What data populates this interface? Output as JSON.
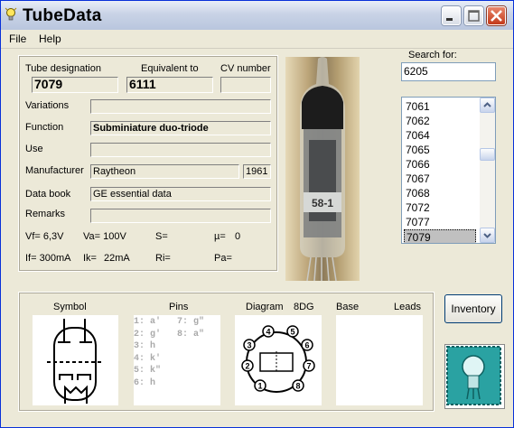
{
  "app": {
    "title": "TubeData"
  },
  "menu": {
    "file": "File",
    "help": "Help"
  },
  "labels": {
    "tube_designation": "Tube designation",
    "equivalent_to": "Equivalent to",
    "cv_number": "CV number",
    "variations": "Variations",
    "function": "Function",
    "use": "Use",
    "manufacturer": "Manufacturer",
    "data_book": "Data book",
    "remarks": "Remarks",
    "search_for": "Search for:"
  },
  "fields": {
    "tube_designation": "7079",
    "equivalent_to": "6111",
    "cv_number": "",
    "variations": "",
    "function": "Subminiature duo-triode",
    "use": "",
    "manufacturer": "Raytheon",
    "year": "1961",
    "data_book": "GE essential data",
    "remarks": ""
  },
  "specs": {
    "vf": "Vf= 6,3V",
    "va": "Va= 100V",
    "s": "S=",
    "mu": "µ=",
    "mu_value": "0",
    "if": "If= 300mA",
    "ik": "Ik=",
    "ik_value": "22mA",
    "ri": "Ri=",
    "pa": "Pa="
  },
  "search": {
    "value": "6205"
  },
  "list": {
    "items": [
      "7061",
      "7062",
      "7064",
      "7065",
      "7066",
      "7067",
      "7068",
      "7072",
      "7077",
      "7079"
    ],
    "selected": "7079"
  },
  "bottom": {
    "symbol": "Symbol",
    "pins": "Pins",
    "diagram": "Diagram",
    "diagram_code": "8DG",
    "base": "Base",
    "leads": "Leads",
    "pins_col1": "1: a'\n2: g'\n3: h\n4: k'\n5: k\"\n6: h",
    "pins_col2": "7: g\"\n8: a\"",
    "pin_numbers": [
      "1",
      "2",
      "3",
      "4",
      "5",
      "6",
      "7",
      "8"
    ]
  },
  "photo": {
    "marking": "58-1"
  },
  "buttons": {
    "inventory": "Inventory"
  },
  "icons": {
    "app": "lightbulb-icon",
    "minimize": "minimize-icon",
    "maximize": "maximize-icon",
    "close": "close-icon",
    "logo": "tubedata-logo-icon"
  },
  "colors": {
    "titlebar": "#c9d3e6",
    "close": "#c3391a",
    "selection": "#c0c0c0",
    "logo": "#1a8a8a"
  }
}
